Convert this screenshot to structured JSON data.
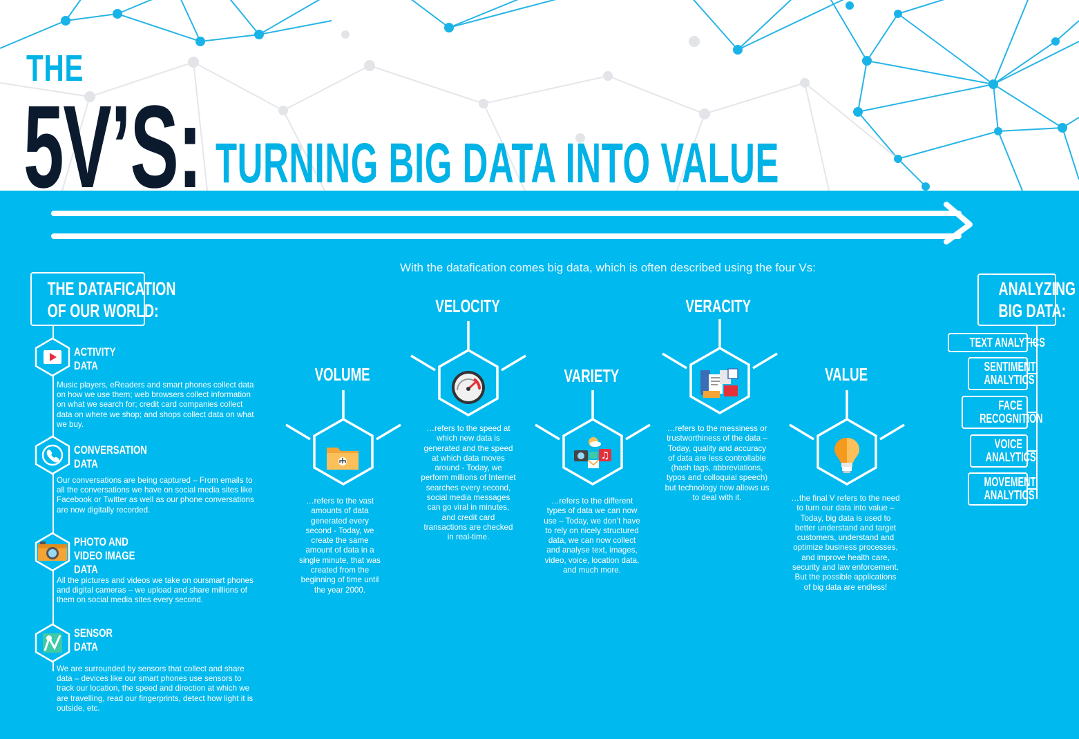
{
  "title": {
    "the": "THE",
    "five_vs": "5V’S:",
    "subtitle": "TURNING BIG DATA INTO VALUE"
  },
  "intro": "With the datafication comes big data, which is often described using the four Vs:",
  "datafication": {
    "heading_line1": "THE DATAFICATION",
    "heading_line2": "OF OUR WORLD:",
    "sources": [
      {
        "title_line1": "ACTIVITY",
        "title_line2": "DATA",
        "title_line3": "",
        "icon": "play-icon",
        "text": "Music players, eReaders and smart phones collect data on how we use them; web browsers collect information on what we search for; credit card companies collect data on where we shop; and shops collect data on what we buy."
      },
      {
        "title_line1": "CONVERSATION",
        "title_line2": "DATA",
        "title_line3": "",
        "icon": "phone-icon",
        "text": "Our conversations are being captured – From emails to all the conversations we have on social media sites like Facebook or Twitter as well as our phone conversations are now digitally recorded."
      },
      {
        "title_line1": "PHOTO AND",
        "title_line2": "VIDEO IMAGE",
        "title_line3": "DATA",
        "icon": "camera-icon",
        "text": "All the pictures and videos we take on oursmart phones and digital cameras – we upload and share millions of  them on social media sites every second."
      },
      {
        "title_line1": "SENSOR",
        "title_line2": "DATA",
        "title_line3": "",
        "icon": "map-pin-icon",
        "text": "We are surrounded by sensors that collect and share data – devices like our smart phones use sensors to track our location, the speed and direction at which we are travelling, read our fingerprints, detect how light it is outside, etc."
      }
    ]
  },
  "vs": [
    {
      "title": "VOLUME",
      "icon": "folder-icon",
      "text": "…refers to the vast amounts of data generated every second - Today, we create the same amount of data in a single minute, that was created from the beginning of time until the year 2000."
    },
    {
      "title": "VELOCITY",
      "icon": "speedometer-icon",
      "text": "…refers to the speed at which new data is generated and the speed at which data moves around - Today, we perform millions of Internet searches every second, social media messages can go viral in minutes, and credit card transactions are checked in real-time."
    },
    {
      "title": "VARIETY",
      "icon": "media-types-icon",
      "text": "…refers to the different types of data we can now use – Today, we don’t have to rely on nicely structured data, we can now collect and analyse text, images, video, voice, location data, and much more."
    },
    {
      "title": "VERACITY",
      "icon": "documents-icon",
      "text": "…refers to the messiness or trustworthiness of the data – Today, quality and accuracy of data are less controllable (hash tags, abbreviations, typos and colloquial speech) but technology now allows us to deal with it."
    },
    {
      "title": "VALUE",
      "icon": "lightbulb-icon",
      "text": "…the final V refers to the need to turn our data into value – Today, big data is used to better understand and target customers, understand and optimize business processes, and improve health care, security and law enforcement. But the possible applications of big data are endless!"
    }
  ],
  "analyzing": {
    "heading_line1": "ANALYZING",
    "heading_line2": "BIG DATA:",
    "items": [
      {
        "line1": "TEXT ANALYTICS",
        "line2": ""
      },
      {
        "line1": "SENTIMENT",
        "line2": "ANALYTICS"
      },
      {
        "line1": "FACE",
        "line2": "RECOGNITION"
      },
      {
        "line1": "VOICE",
        "line2": "ANALYTICS"
      },
      {
        "line1": "MOVEMENT",
        "line2": "ANALYTICS"
      }
    ]
  },
  "colors": {
    "background": "#00b9ee",
    "title_dark": "#0c1a2e",
    "title_blue": "#00b2e6",
    "network": "#1ab3e8"
  }
}
